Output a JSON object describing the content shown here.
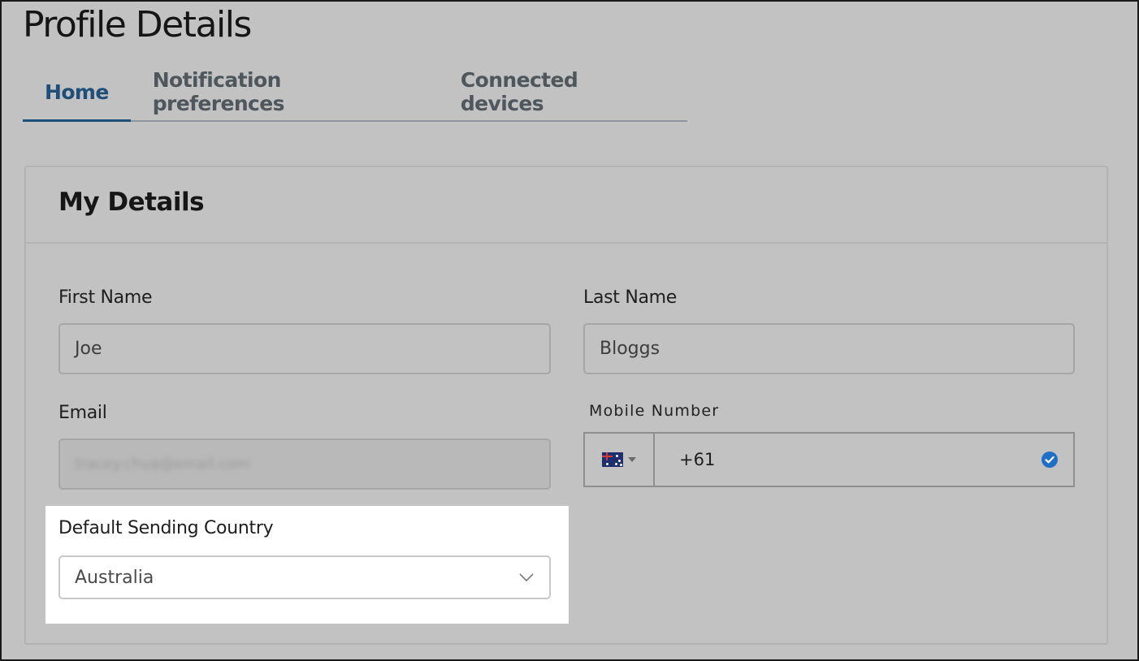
{
  "page": {
    "title": "Profile Details"
  },
  "tabs": [
    {
      "label": "Home",
      "active": true
    },
    {
      "label": "Notification preferences",
      "active": false
    },
    {
      "label": "Connected devices",
      "active": false
    }
  ],
  "card": {
    "title": "My Details"
  },
  "form": {
    "first_name": {
      "label": "First Name",
      "value": "Joe"
    },
    "last_name": {
      "label": "Last Name",
      "value": "Bloggs"
    },
    "email": {
      "label": "Email",
      "value": "tracey.chua@email.com",
      "disabled": true
    },
    "mobile": {
      "label": "Mobile Number",
      "country_flag": "australia-flag-icon",
      "value": "+61",
      "verified": true
    },
    "default_country": {
      "label": "Default Sending Country",
      "value": "Australia"
    }
  },
  "colors": {
    "accent": "#1f4e79",
    "verified": "#1f6fc5",
    "page_bg": "#c2c2c2",
    "highlight_bg": "#ffffff"
  }
}
